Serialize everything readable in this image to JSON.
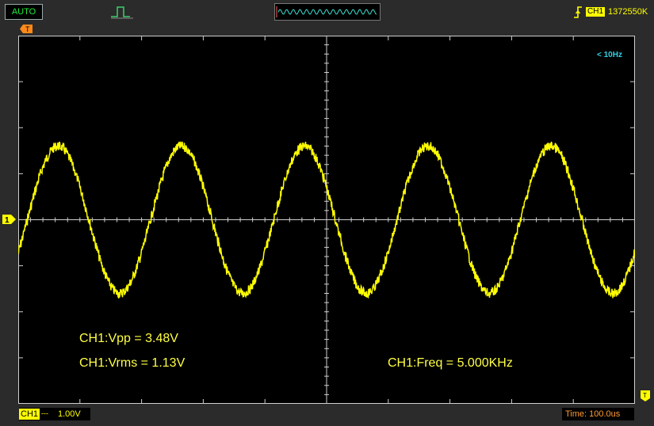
{
  "toolbar": {
    "mode": "AUTO",
    "trigger_channel": "CH1",
    "trigger_value": "1372550K"
  },
  "screen": {
    "frequency_hint": "< 10Hz",
    "channel_marker": "1"
  },
  "measurements": {
    "vpp": "CH1:Vpp = 3.48V",
    "vrms": "CH1:Vrms = 1.13V",
    "freq": "CH1:Freq = 5.000KHz"
  },
  "status": {
    "channel": "CH1",
    "coupling": "---",
    "volts_div": "1.00V",
    "time_base": "Time: 100.0us"
  },
  "colors": {
    "trace": "#ffff00",
    "grid": "#cfcfcf",
    "mode_text": "#1cf03a",
    "time_text": "#ff9a33",
    "hint_text": "#2fd2e6"
  },
  "icons": [
    "pulse-icon",
    "mini-waveform-icon",
    "rising-edge-trigger-icon",
    "trigger-position-marker-icon",
    "channel-level-marker-icon",
    "timebase-end-marker-icon"
  ]
}
